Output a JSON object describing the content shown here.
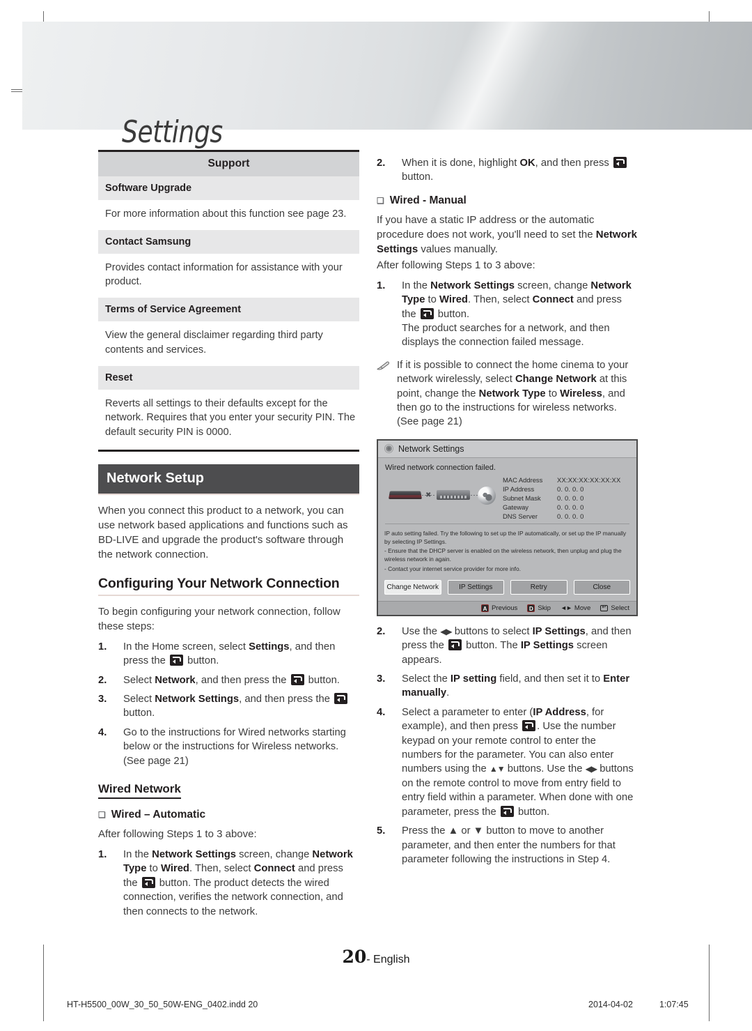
{
  "header": {
    "title": "Settings"
  },
  "support_table": {
    "head": "Support",
    "rows": [
      {
        "label": "Software Upgrade",
        "body": "For more information about this function see page 23."
      },
      {
        "label": "Contact Samsung",
        "body": "Provides contact information for assistance with your product."
      },
      {
        "label": "Terms of Service Agreement",
        "body": "View the general disclaimer regarding third party contents and services."
      },
      {
        "label": "Reset",
        "body": "Reverts all settings to their defaults except for the network. Requires that you enter your security PIN. The default security PIN is 0000."
      }
    ]
  },
  "network_setup": {
    "bar_title": "Network Setup",
    "intro": "When you connect this product to a network, you can use network based applications and functions such as BD-LIVE and upgrade the product's software through the network connection.",
    "subhead": "Configuring Your Network Connection",
    "lead": "To begin configuring your network connection, follow these steps:",
    "steps": [
      {
        "num": "1.",
        "html": "In the Home screen, select <b>Settings</b>, and then press the <span class=\"keyico\" data-name=\"enter-key-icon\"></span> button."
      },
      {
        "num": "2.",
        "html": "Select <b>Network</b>, and then press the <span class=\"keyico\" data-name=\"enter-key-icon\"></span> button."
      },
      {
        "num": "3.",
        "html": "Select <b>Network Settings</b>, and then press the <span class=\"keyico\" data-name=\"enter-key-icon\"></span> button."
      },
      {
        "num": "4.",
        "html": "Go to the instructions for Wired networks starting below or the instructions for Wireless networks. (See page 21)"
      }
    ]
  },
  "wired_network": {
    "heading": "Wired Network",
    "automatic": {
      "bullet": "Wired – Automatic",
      "lead": "After following Steps 1 to 3 above:",
      "steps": [
        {
          "num": "1.",
          "html": "In the <b>Network Settings</b> screen, change <b>Network Type</b> to <b>Wired</b>. Then, select <b>Connect</b> and press the <span class=\"keyico\" data-name=\"enter-key-icon\"></span> button. The product detects the wired connection, verifies the network connection, and then connects to the network."
        },
        {
          "num": "2.",
          "html": "When it is done, highlight <b>OK</b>, and then press <span class=\"keyico\" data-name=\"enter-key-icon\"></span> button."
        }
      ]
    },
    "manual": {
      "bullet": "Wired - Manual",
      "intro": "If you have a static IP address or the automatic procedure does not work, you'll need to set the <b>Network Settings</b> values manually.",
      "lead": "After following Steps 1 to 3 above:",
      "step1": {
        "num": "1.",
        "html": "In the <b>Network Settings</b> screen, change <b>Network Type</b> to <b>Wired</b>. Then, select <b>Connect</b> and press the <span class=\"keyico\" data-name=\"enter-key-icon\"></span> button.<br>The product searches for a network, and then displays the connection failed message."
      },
      "note": "If it is possible to connect the home cinema to your network wirelessly, select <b>Change Network</b> at this point, change the <b>Network Type</b> to <b>Wireless</b>, and then go to the instructions for wireless networks. (See page 21)",
      "steps_after": [
        {
          "num": "2.",
          "html": "Use the <span class=\"arr\">◀▶</span> buttons to select <b>IP Settings</b>, and then press the <span class=\"keyico\" data-name=\"enter-key-icon\"></span> button. The <b>IP Settings</b> screen appears."
        },
        {
          "num": "3.",
          "html": "Select the <b>IP setting</b> field, and then set it to <b>Enter manually</b>."
        },
        {
          "num": "4.",
          "html": "Select a parameter to enter (<b>IP Address</b>, for example), and then press <span class=\"keyico\" data-name=\"enter-key-icon\"></span>. Use the number keypad on your remote control to enter the numbers for the parameter. You can also enter numbers using the <span class=\"arr\">▲▼</span> buttons. Use the <span class=\"arr\">◀▶</span> buttons on the remote control to move from entry field to entry field within a parameter. When done with one parameter, press the <span class=\"keyico\" data-name=\"enter-key-icon\"></span> button."
        },
        {
          "num": "5.",
          "html": "Press the ▲ or ▼ button to move to another parameter, and then enter the numbers for that parameter following the instructions in Step 4."
        }
      ]
    }
  },
  "osd_dialog": {
    "title": "Network Settings",
    "failed_message": "Wired network connection failed.",
    "info_rows": [
      {
        "key": "MAC Address",
        "value": "XX:XX:XX:XX:XX:XX"
      },
      {
        "key": "IP Address",
        "value": "0.  0.  0.  0"
      },
      {
        "key": "Subnet Mask",
        "value": "0.  0.  0.  0"
      },
      {
        "key": "Gateway",
        "value": "0.  0.  0.  0"
      },
      {
        "key": "DNS Server",
        "value": "0.  0.  0.  0"
      }
    ],
    "help_lines": [
      "IP auto setting failed. Try the following to set up the IP automatically, or set up the IP manually by selecting IP Settings.",
      "- Ensure that the DHCP server is enabled on the wireless network, then unplug and plug the wireless network in again.",
      "- Contact your internet service provider for more info."
    ],
    "buttons": [
      {
        "label": "Change Network",
        "selected": true
      },
      {
        "label": "IP Settings",
        "selected": false
      },
      {
        "label": "Retry",
        "selected": false
      },
      {
        "label": "Close",
        "selected": false
      }
    ],
    "footer_hints": [
      {
        "badge": "A",
        "label": "Previous"
      },
      {
        "badge": "D",
        "label": "Skip"
      },
      {
        "badge": "",
        "label": "Move"
      },
      {
        "badge": "",
        "label": "Select"
      }
    ]
  },
  "footer": {
    "page_number": "20",
    "page_language": "- English",
    "file_name": "HT-H5500_00W_30_50_50W-ENG_0402.indd   20",
    "date": "2014-04-02",
    "time": "1:07:45"
  },
  "colors": {
    "accent_bar": "#4d4d4f",
    "table_head": "#d2d3d5",
    "table_sub": "#e7e7e8",
    "rule": "#e6d8d4"
  }
}
